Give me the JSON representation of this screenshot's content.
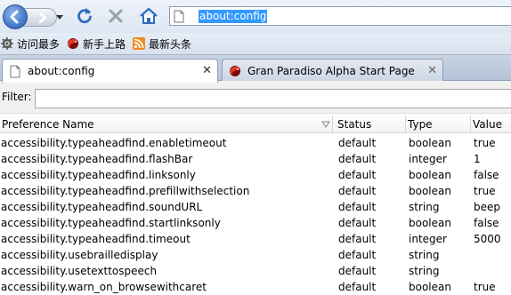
{
  "toolbar": {
    "url": "about:config"
  },
  "bookmarks": [
    {
      "label": "访问最多",
      "icon": "gear-icon"
    },
    {
      "label": "新手上路",
      "icon": "firefox-icon"
    },
    {
      "label": "最新头条",
      "icon": "rss-feed-icon"
    }
  ],
  "tabs": [
    {
      "label": "about:config",
      "active": true,
      "icon": "page-icon"
    },
    {
      "label": "Gran Paradiso Alpha Start Page",
      "active": false,
      "icon": "firefox-icon"
    }
  ],
  "filter": {
    "label": "Filter:",
    "value": ""
  },
  "table": {
    "columns": [
      "Preference Name",
      "Status",
      "Type",
      "Value"
    ],
    "rows": [
      [
        "accessibility.typeaheadfind.enabletimeout",
        "default",
        "boolean",
        "true"
      ],
      [
        "accessibility.typeaheadfind.flashBar",
        "default",
        "integer",
        "1"
      ],
      [
        "accessibility.typeaheadfind.linksonly",
        "default",
        "boolean",
        "false"
      ],
      [
        "accessibility.typeaheadfind.prefillwithselection",
        "default",
        "boolean",
        "true"
      ],
      [
        "accessibility.typeaheadfind.soundURL",
        "default",
        "string",
        "beep"
      ],
      [
        "accessibility.typeaheadfind.startlinksonly",
        "default",
        "boolean",
        "false"
      ],
      [
        "accessibility.typeaheadfind.timeout",
        "default",
        "integer",
        "5000"
      ],
      [
        "accessibility.usebrailledisplay",
        "default",
        "string",
        ""
      ],
      [
        "accessibility.usetexttospeech",
        "default",
        "string",
        ""
      ],
      [
        "accessibility.warn_on_browsewithcaret",
        "default",
        "boolean",
        "true"
      ]
    ]
  }
}
